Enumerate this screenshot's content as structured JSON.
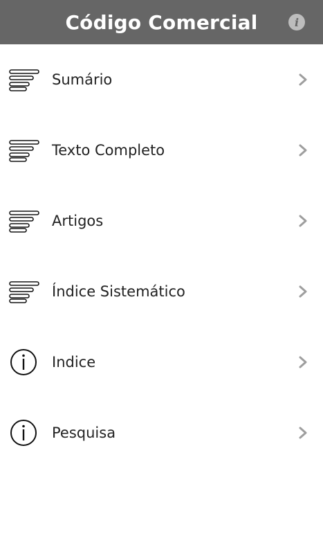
{
  "header": {
    "title": "Código Comercial",
    "info_glyph": "i",
    "background": "#666666"
  },
  "menu": {
    "items": [
      {
        "label": "Sumário",
        "icon": "list-lines-icon"
      },
      {
        "label": "Texto Completo",
        "icon": "list-lines-icon"
      },
      {
        "label": "Artigos",
        "icon": "list-lines-icon"
      },
      {
        "label": "Índice Sistemático",
        "icon": "list-lines-icon"
      },
      {
        "label": "Indice",
        "icon": "info-circle-icon"
      },
      {
        "label": "Pesquisa",
        "icon": "info-circle-icon"
      }
    ],
    "chevron_icon": "chevron-right-icon"
  }
}
